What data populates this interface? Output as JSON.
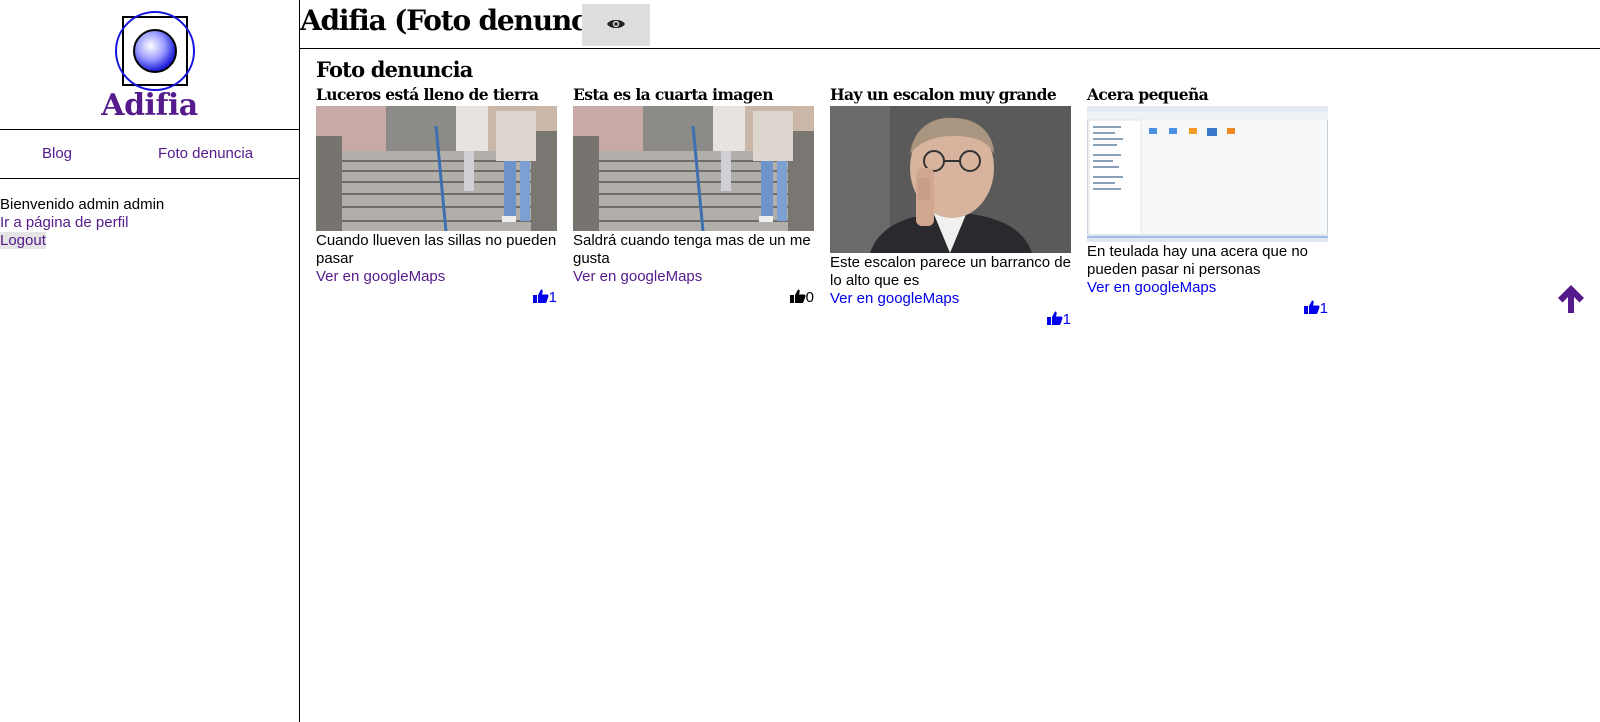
{
  "site": {
    "name": "Adifia",
    "logo_icon": "sphere-logo-icon"
  },
  "nav": {
    "blog": "Blog",
    "foto": "Foto denuncia"
  },
  "user": {
    "welcome": "Bienvenido admin admin",
    "profile_link": "Ir a página de perfil",
    "logout": "Logout"
  },
  "header": {
    "title": "Adifia (Foto denuncia)",
    "eye_icon": "eye-icon"
  },
  "section": {
    "title": "Foto denuncia"
  },
  "cards": [
    {
      "title": "Luceros está lleno de tierra",
      "description": "Cuando llueven las sillas no pueden pasar",
      "map_link": "Ver en googleMaps",
      "likes": "1",
      "image": "stairs-photo",
      "liked": true,
      "link_color": "#551a8b"
    },
    {
      "title": "Esta es la cuarta imagen",
      "description": "Saldrá cuando tenga mas de un me gusta",
      "map_link": "Ver en googleMaps",
      "likes": "0",
      "image": "stairs-photo",
      "liked": false,
      "link_color": "#551a8b"
    },
    {
      "title": "Hay un escalon muy grande",
      "description": "Este escalon parece un barranco de lo alto que es",
      "map_link": "Ver en googleMaps",
      "likes": "1",
      "image": "portrait-photo",
      "liked": true,
      "link_color": "#0000ee"
    },
    {
      "title": "Acera pequeña",
      "description": "En teulada hay una acera que no pueden pasar ni personas",
      "map_link": "Ver en googleMaps",
      "likes": "1",
      "image": "file-manager-screenshot",
      "liked": true,
      "link_color": "#0000ee"
    }
  ],
  "scroll_top": {
    "icon": "arrow-up-icon"
  },
  "colors": {
    "visited_link": "#551a8b",
    "link": "#0000ee",
    "like_active": "#0000ee",
    "like_inactive": "#000000"
  }
}
